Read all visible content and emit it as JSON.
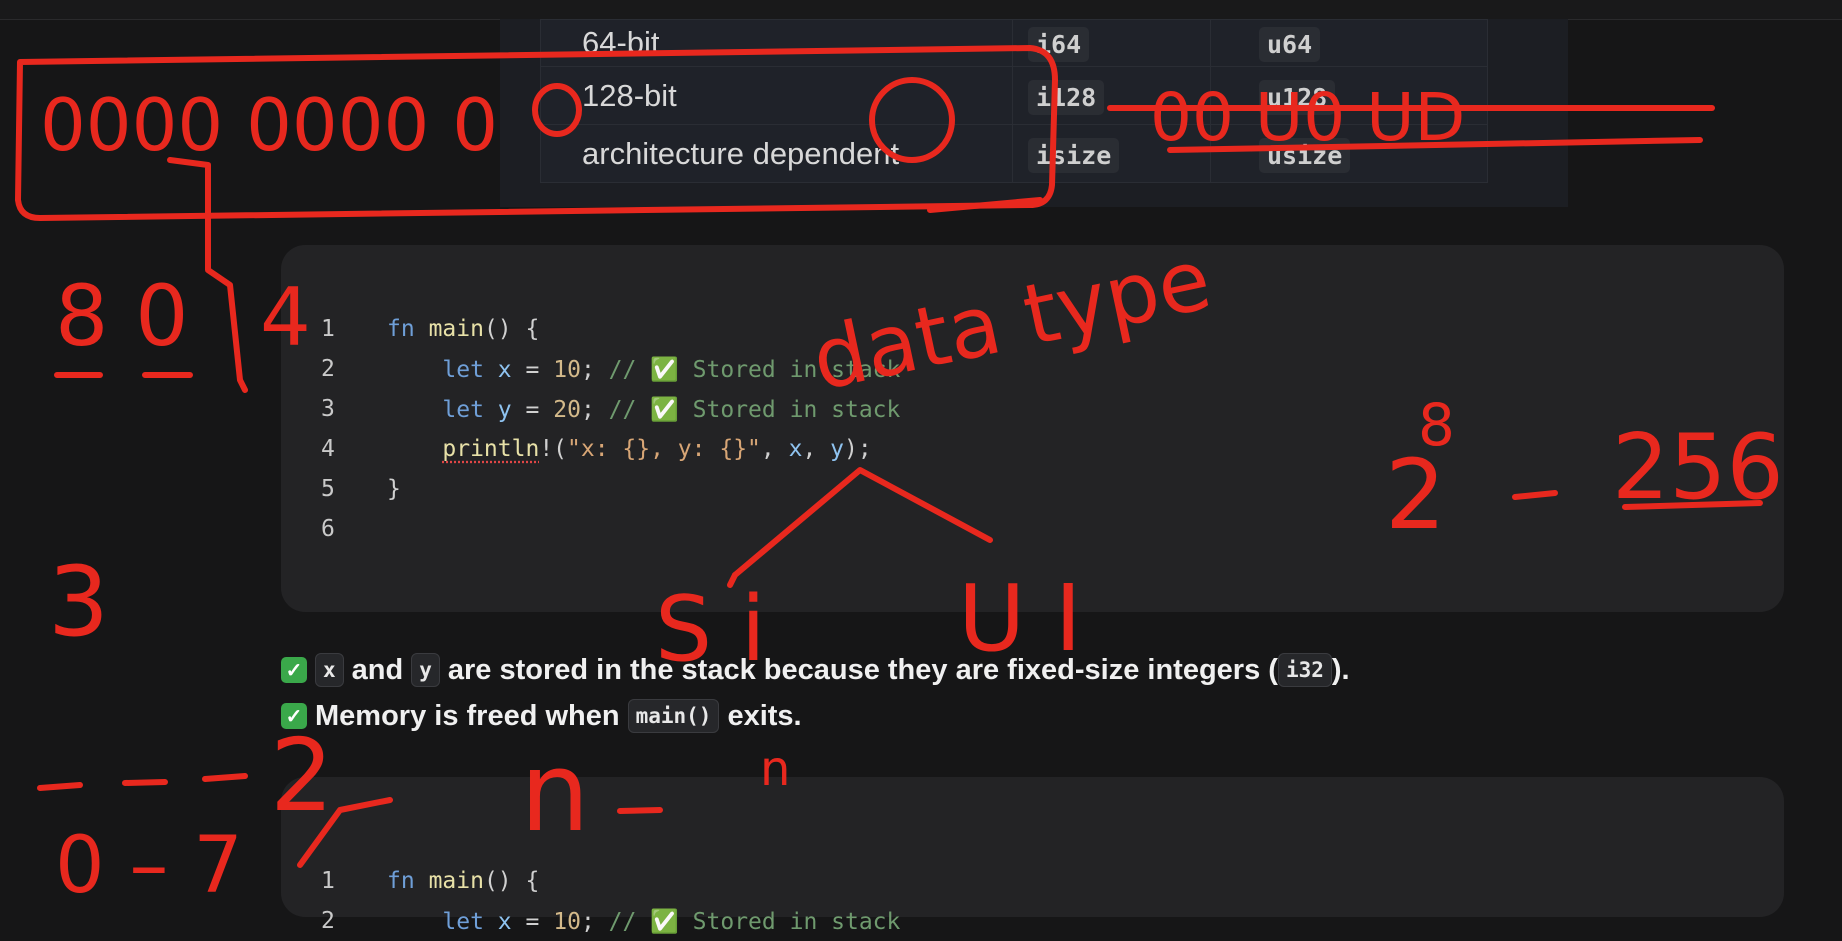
{
  "table": {
    "rows": [
      {
        "name": "64-bit",
        "signed": "i64",
        "unsigned": "u64"
      },
      {
        "name": "128-bit",
        "signed": "i128",
        "unsigned": "u128"
      },
      {
        "name": "architecture dependent",
        "signed": "isize",
        "unsigned": "usize"
      }
    ]
  },
  "code1": {
    "lines": [
      {
        "n": "1"
      },
      {
        "n": "2",
        "comment": "// ✅ Stored in stack"
      },
      {
        "n": "3",
        "comment": "// ✅ Stored in stack"
      },
      {
        "n": "4"
      },
      {
        "n": "5"
      },
      {
        "n": "6"
      }
    ]
  },
  "prose": {
    "line1": {
      "x": "x",
      "and": "and",
      "y": "y",
      "text": "are stored in the stack because they are fixed-size integers (",
      "type": "i32",
      "end": ")."
    },
    "line2": {
      "text": "Memory is freed when",
      "fn": "main()",
      "end": "exits."
    }
  },
  "code2": {
    "lines": [
      {
        "n": "1"
      },
      {
        "n": "2",
        "comment": "// ✅ Stored in stack"
      }
    ]
  },
  "annotations": {
    "binary": "0000 0000 0",
    "binary_right": "00 U0 UD",
    "data_type": "data type",
    "si": "S i",
    "ui": "U I",
    "power": "8",
    "two": "2",
    "two56": "256",
    "n_label": "n",
    "n_power": "n",
    "three": "3",
    "zero_seven": "0 – 7",
    "two_b": "2",
    "four": "4",
    "digits_left": "8 0"
  },
  "colors": {
    "ink": "#e8281e",
    "background": "#161617",
    "codeblock": "#232325"
  }
}
